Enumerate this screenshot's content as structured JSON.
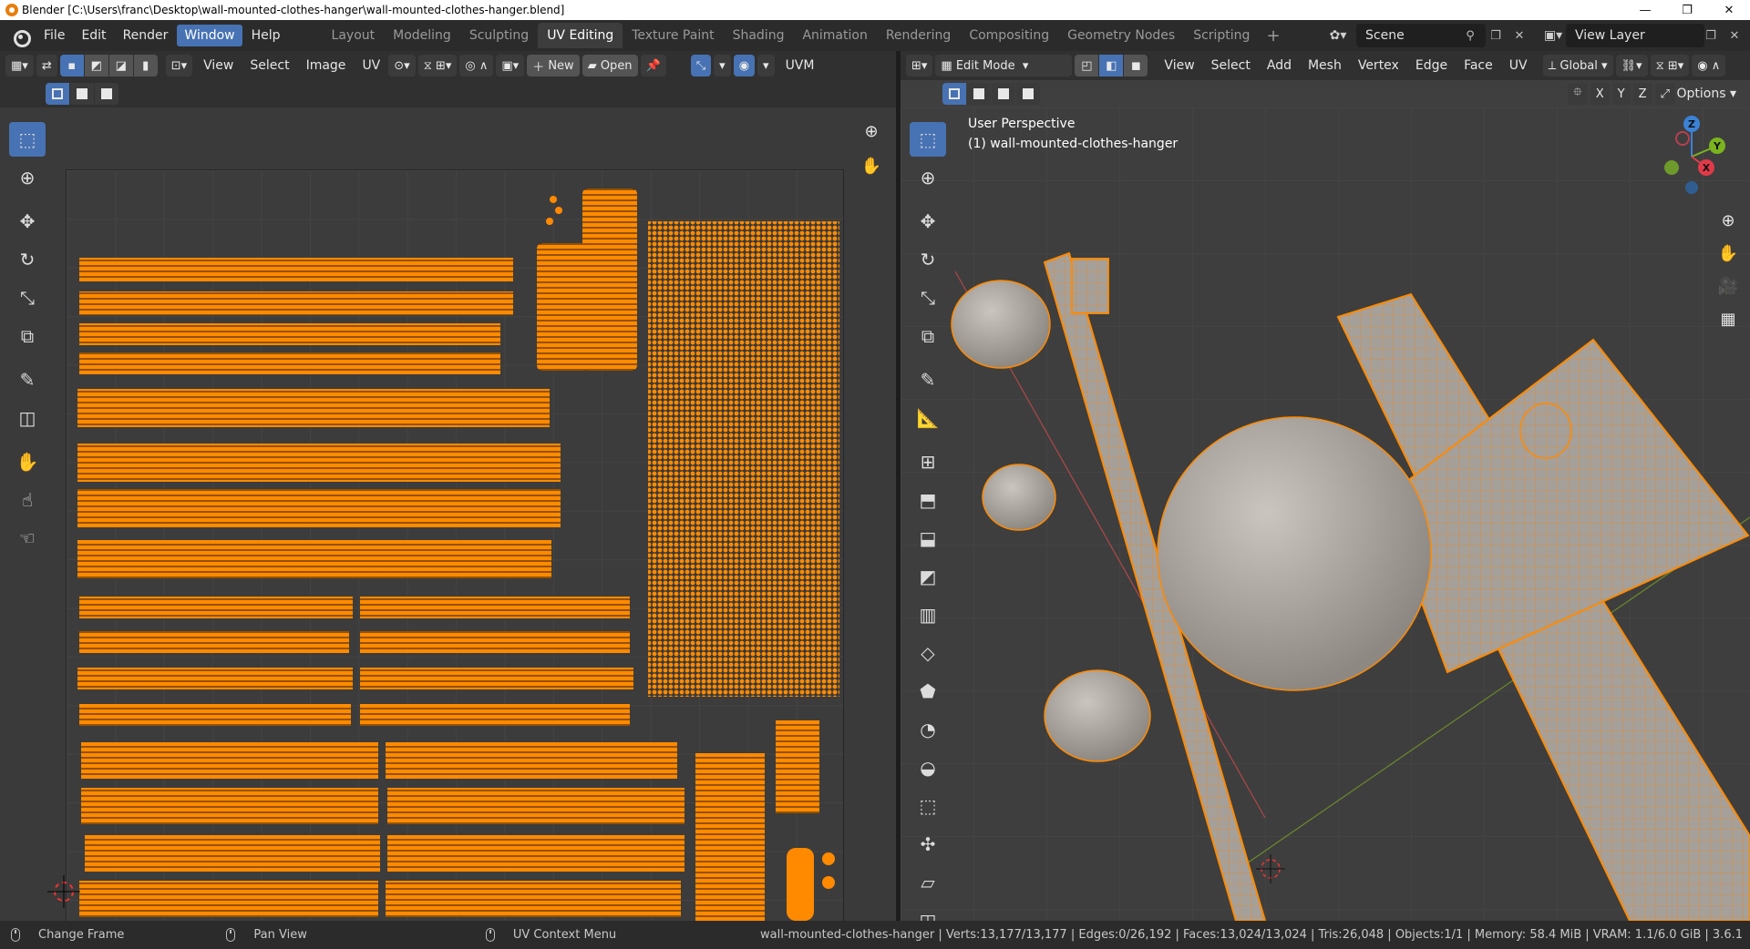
{
  "window": {
    "title": "Blender [C:\\Users\\franc\\Desktop\\wall-mounted-clothes-hanger\\wall-mounted-clothes-hanger.blend]",
    "minimize": "—",
    "maximize": "❐",
    "close": "✕"
  },
  "menu": {
    "file": "File",
    "edit": "Edit",
    "render": "Render",
    "window": "Window",
    "help": "Help"
  },
  "workspaces": [
    "Layout",
    "Modeling",
    "Sculpting",
    "UV Editing",
    "Texture Paint",
    "Shading",
    "Animation",
    "Rendering",
    "Compositing",
    "Geometry Nodes",
    "Scripting"
  ],
  "active_workspace": "UV Editing",
  "scene": {
    "name": "Scene",
    "view_layer": "View Layer"
  },
  "uv_editor": {
    "menus": [
      "View",
      "Select",
      "Image",
      "UV"
    ],
    "new_label": "New",
    "open_label": "Open",
    "uvmap_label": "UVM"
  },
  "viewport": {
    "mode": "Edit Mode",
    "menus": [
      "View",
      "Select",
      "Add",
      "Mesh",
      "Vertex",
      "Edge",
      "Face",
      "UV"
    ],
    "transform_orientation": "Global",
    "axis_x": "X",
    "axis_y": "Y",
    "axis_z": "Z",
    "options_label": "Options",
    "perspective": "User Perspective",
    "object_label": "(1) wall-mounted-clothes-hanger",
    "gizmo": {
      "x": "X",
      "y": "Y",
      "z": "Z"
    }
  },
  "status": {
    "hint_left": "Change Frame",
    "hint_middle": "Pan View",
    "hint_right": "UV Context Menu",
    "stats": "wall-mounted-clothes-hanger | Verts:13,177/13,177 | Edges:0/26,192 | Faces:13,024/13,024 | Tris:26,048 | Objects:1/1 | Memory: 58.4 MiB | VRAM: 1.1/6.0 GiB | 3.6.1"
  },
  "colors": {
    "accent": "#4772b3",
    "selection": "#ff8a00",
    "mesh": "#9a9a9a"
  }
}
